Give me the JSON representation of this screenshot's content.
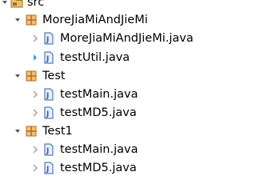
{
  "tree": {
    "root": {
      "label": "src"
    },
    "packages": [
      {
        "label": "MoreJiaMiAndJieMi",
        "files": [
          {
            "label": "MoreJiaMiAndJieMi.java"
          },
          {
            "label": "testUtil.java"
          }
        ]
      },
      {
        "label": "Test",
        "files": [
          {
            "label": "testMain.java"
          },
          {
            "label": "testMD5.java"
          }
        ]
      },
      {
        "label": "Test1",
        "files": [
          {
            "label": "testMain.java"
          },
          {
            "label": "testMD5.java"
          }
        ]
      }
    ]
  },
  "colors": {
    "arrow": "#7f7f7f",
    "arrow_hover": "#2b9fe0",
    "package_icon": "#b36b1b",
    "package_icon_light": "#f2c27a",
    "java_file_icon": "#2f5fa8",
    "java_file_bg": "#e8f0fb"
  },
  "icons": {
    "expanded": "chevron-down-icon",
    "collapsed": "chevron-right-icon",
    "source_folder": "source-folder-icon",
    "package": "package-icon",
    "java_file": "java-file-icon"
  }
}
